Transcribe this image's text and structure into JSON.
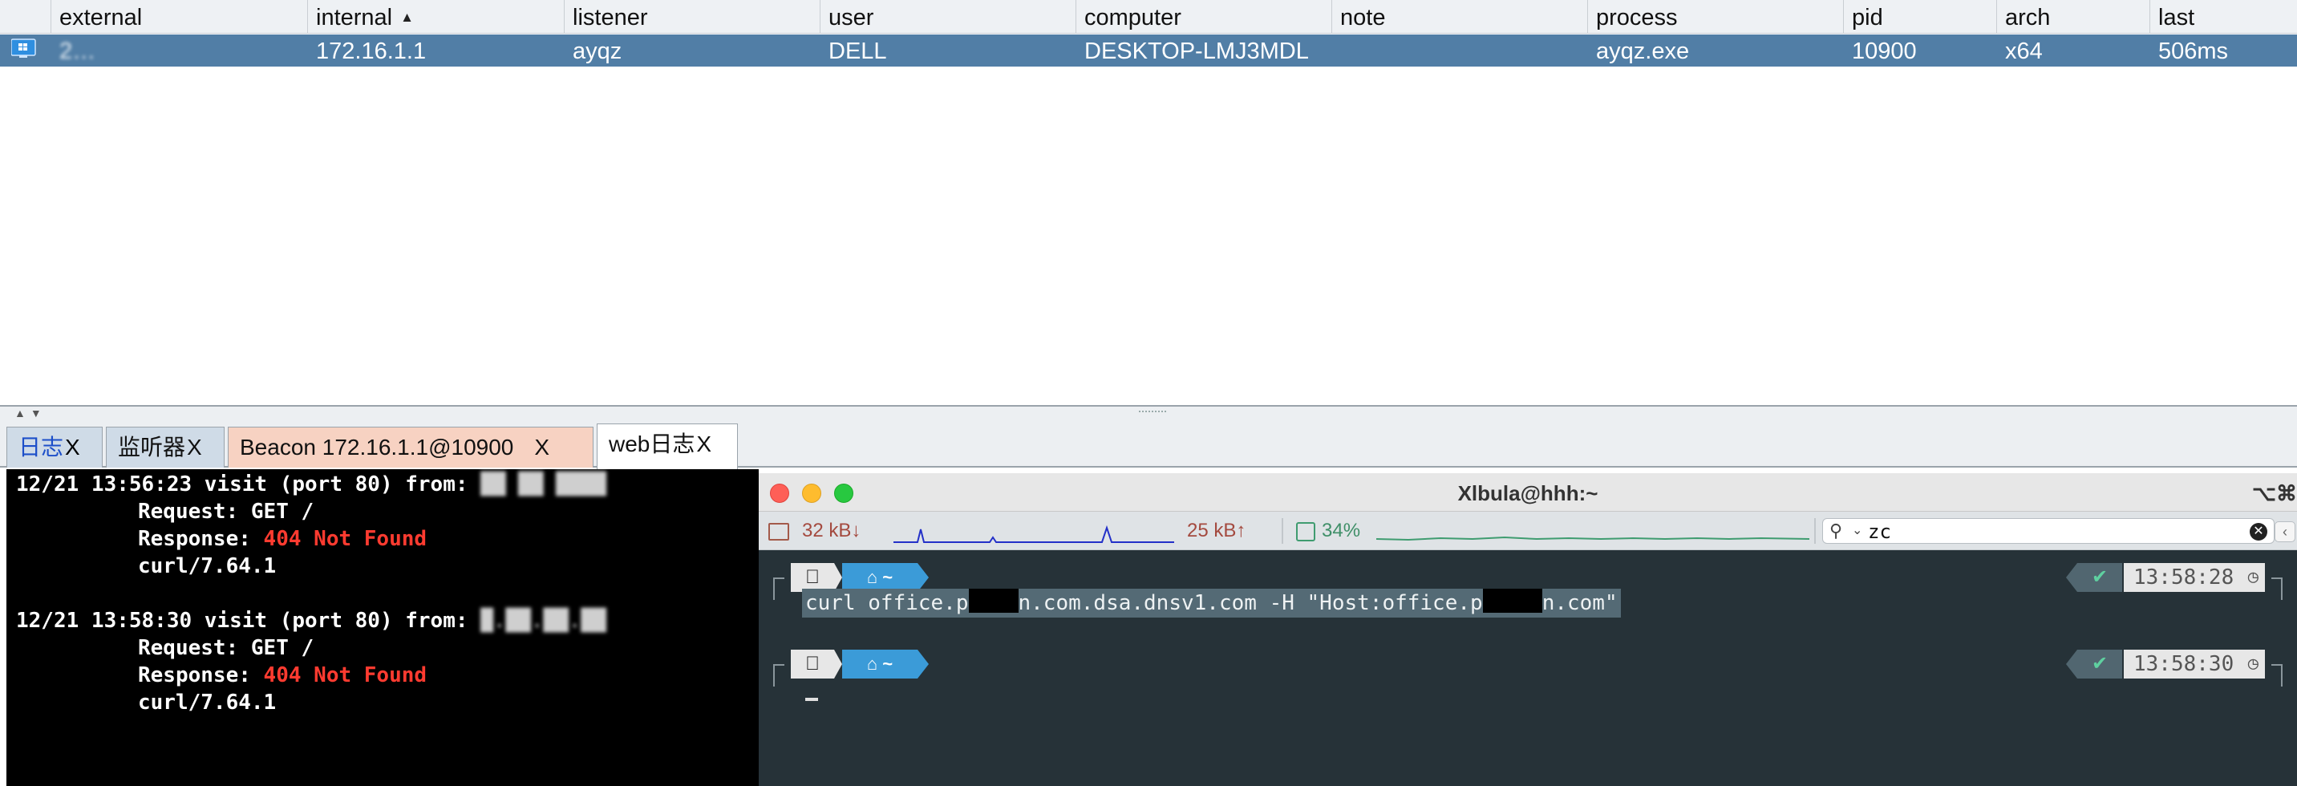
{
  "table": {
    "columns": [
      {
        "key": "icon",
        "label": ""
      },
      {
        "key": "external",
        "label": "external"
      },
      {
        "key": "internal",
        "label": "internal"
      },
      {
        "key": "listener",
        "label": "listener"
      },
      {
        "key": "user",
        "label": "user"
      },
      {
        "key": "computer",
        "label": "computer"
      },
      {
        "key": "note",
        "label": "note"
      },
      {
        "key": "process",
        "label": "process"
      },
      {
        "key": "pid",
        "label": "pid"
      },
      {
        "key": "arch",
        "label": "arch"
      },
      {
        "key": "last",
        "label": "last"
      }
    ],
    "sort_column": "internal",
    "sort_direction": "ascending",
    "selected_row_color": "#517ea6",
    "rows": [
      {
        "icon": "windows-icon",
        "external": "2…",
        "external_obscured": true,
        "internal": "172.16.1.1",
        "listener": "ayqz",
        "user": "DELL",
        "computer": "DESKTOP-LMJ3MDL",
        "note": "",
        "process": "ayqz.exe",
        "pid": "10900",
        "arch": "x64",
        "last": "506ms"
      }
    ]
  },
  "tabs": [
    {
      "label": "日志",
      "close": "X",
      "active": false
    },
    {
      "label": "监听器",
      "close": "X",
      "active": false
    },
    {
      "label": "Beacon 172.16.1.1@10900",
      "close": "X",
      "active": false
    },
    {
      "label": "web日志",
      "close": "X",
      "active": true
    }
  ],
  "weblog": {
    "entries": [
      {
        "header": "12/21 13:56:23 visit (port 80) from: ",
        "request_label": "Request:",
        "request_value": "GET /",
        "response_label": "Response:",
        "response_value": "404 Not Found",
        "agent": "curl/7.64.1"
      },
      {
        "header": "12/21 13:58:30 visit (port 80) from: ",
        "request_label": "Request:",
        "request_value": "GET /",
        "response_label": "Response:",
        "response_value": "404 Not Found",
        "agent": "curl/7.64.1"
      }
    ]
  },
  "terminal": {
    "title": "Xlbula@hhh:~",
    "shortcut": "⌥⌘",
    "status": {
      "net_down": "32 kB↓",
      "net_up": "25 kB↑",
      "cpu": "34%"
    },
    "search": {
      "value": "zc"
    },
    "prompts": [
      {
        "os_icon": "apple-icon",
        "dir_icon": "home-icon",
        "dir": "~",
        "status": "✔",
        "time": "13:58:28"
      },
      {
        "os_icon": "apple-icon",
        "dir_icon": "home-icon",
        "dir": "~",
        "status": "✔",
        "time": "13:58:30"
      }
    ],
    "command": {
      "part1": "curl office.p",
      "part2": "n.com.dsa.dnsv1.com -H \"Host:office.p",
      "part3": "n.com\""
    },
    "colors": {
      "background": "#263238",
      "prompt_home": "#3b9bd8",
      "error_text": "#ff3b30"
    }
  }
}
